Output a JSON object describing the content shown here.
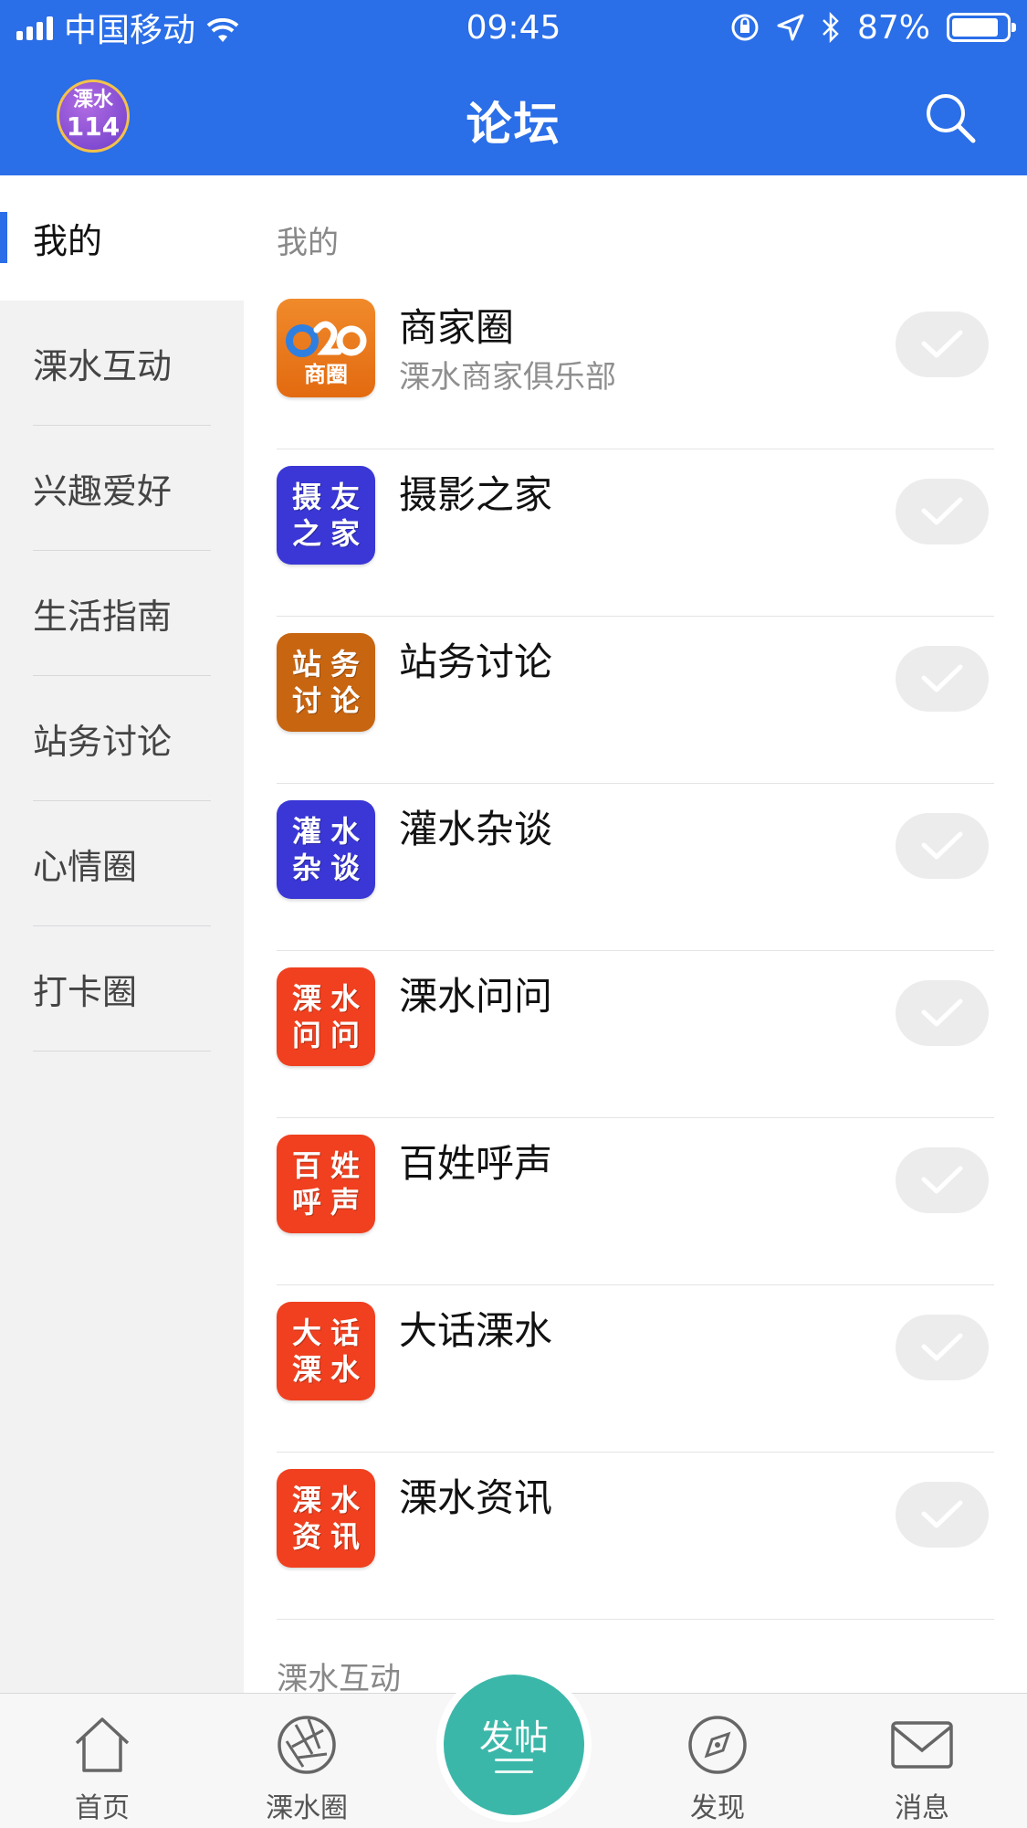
{
  "status_bar": {
    "carrier": "中国移动",
    "time": "09:45",
    "battery": "87%",
    "battery_level": 0.87
  },
  "nav": {
    "logo_top": "溧水",
    "logo_bottom": "114",
    "title": "论坛"
  },
  "sidebar": {
    "items": [
      {
        "label": "我的",
        "active": true
      },
      {
        "label": "溧水互动"
      },
      {
        "label": "兴趣爱好"
      },
      {
        "label": "生活指南"
      },
      {
        "label": "站务讨论"
      },
      {
        "label": "心情圈"
      },
      {
        "label": "打卡圈"
      }
    ]
  },
  "main": {
    "section_mine": "我的",
    "section_next": "溧水互动",
    "forums": [
      {
        "name": "商家圈",
        "sub": "溧水商家俱乐部",
        "tile": [
          "o2o",
          "商圈"
        ],
        "color": "#ec7b1c"
      },
      {
        "name": "摄影之家",
        "sub": "",
        "tile": [
          "摄",
          "友",
          "之",
          "家"
        ],
        "color": "#3a37d6"
      },
      {
        "name": "站务讨论",
        "sub": "",
        "tile": [
          "站",
          "务",
          "讨",
          "论"
        ],
        "color": "#c86511"
      },
      {
        "name": "灌水杂谈",
        "sub": "",
        "tile": [
          "灌",
          "水",
          "杂",
          "谈"
        ],
        "color": "#3a37d6"
      },
      {
        "name": "溧水问问",
        "sub": "",
        "tile": [
          "溧",
          "水",
          "问",
          "问"
        ],
        "color": "#f0401f"
      },
      {
        "name": "百姓呼声",
        "sub": "",
        "tile": [
          "百",
          "姓",
          "呼",
          "声"
        ],
        "color": "#f0401f"
      },
      {
        "name": "大话溧水",
        "sub": "",
        "tile": [
          "大",
          "话",
          "溧",
          "水"
        ],
        "color": "#f0401f"
      },
      {
        "name": "溧水资讯",
        "sub": "",
        "tile": [
          "溧",
          "水",
          "资",
          "讯"
        ],
        "color": "#f0401f"
      }
    ]
  },
  "tabs": {
    "home": "首页",
    "circle": "溧水圈",
    "post": "发帖",
    "discover": "发现",
    "messages": "消息"
  },
  "colors": {
    "accent": "#2a6ee8",
    "post_button": "#3bb7a9"
  }
}
